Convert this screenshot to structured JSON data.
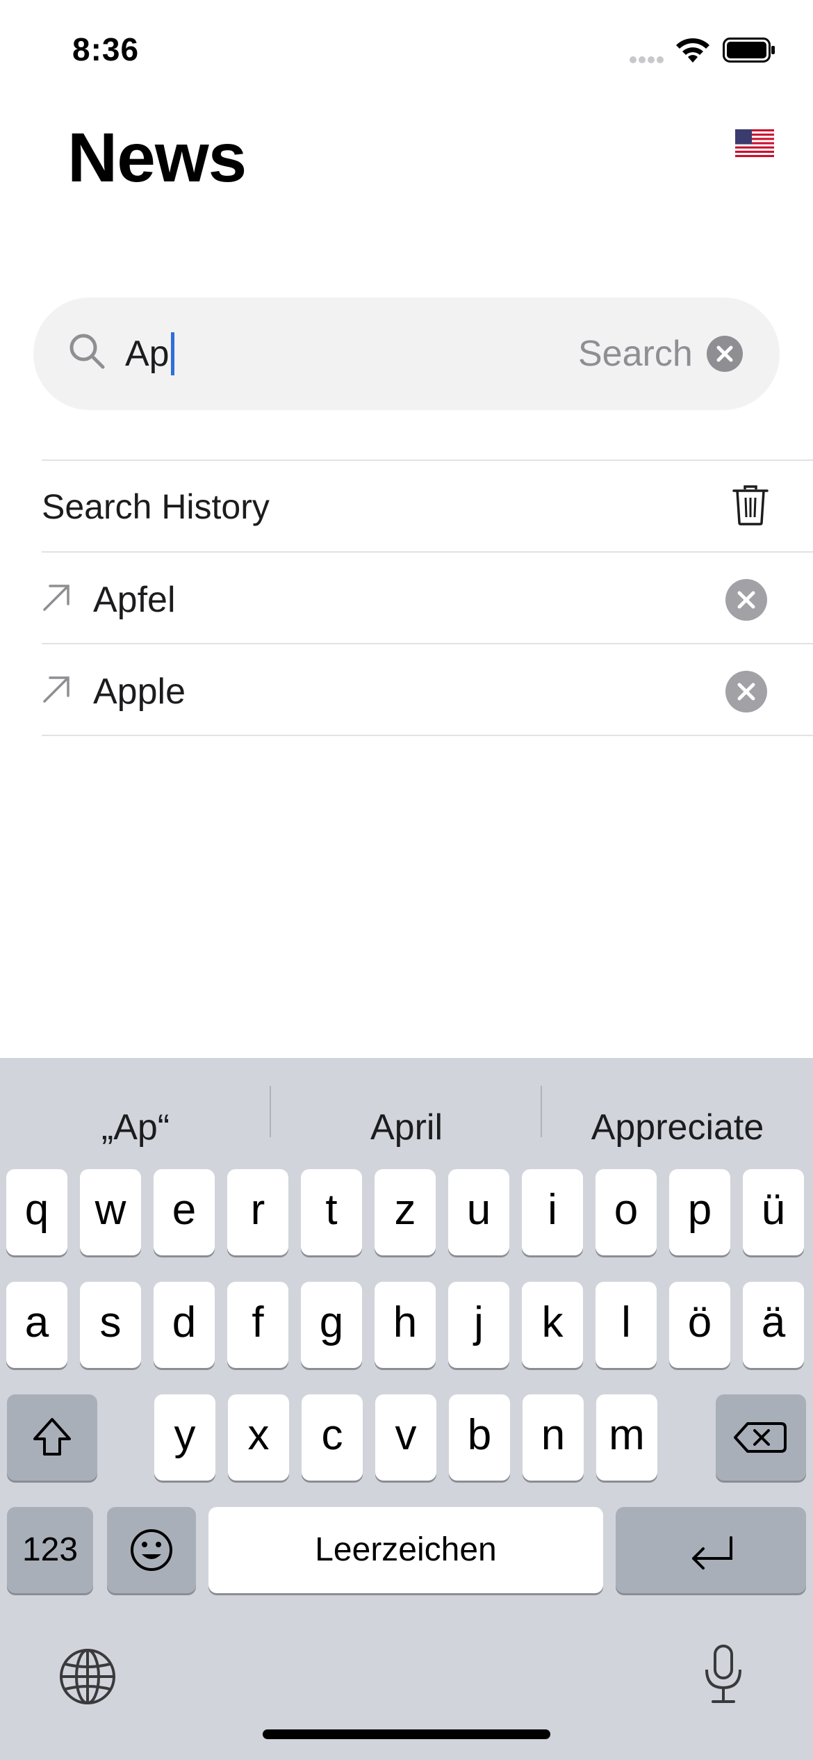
{
  "status_bar": {
    "time": "8:36"
  },
  "header": {
    "title": "News",
    "flag_icon": "us-flag-icon"
  },
  "search": {
    "value": "Ap",
    "placeholder": "Search",
    "button_label": "Search"
  },
  "history": {
    "title": "Search History",
    "items": [
      {
        "label": "Apfel"
      },
      {
        "label": "Apple"
      }
    ]
  },
  "keyboard": {
    "suggestions": [
      "„Ap“",
      "April",
      "Appreciate"
    ],
    "row1": [
      "q",
      "w",
      "e",
      "r",
      "t",
      "z",
      "u",
      "i",
      "o",
      "p",
      "ü"
    ],
    "row2": [
      "a",
      "s",
      "d",
      "f",
      "g",
      "h",
      "j",
      "k",
      "l",
      "ö",
      "ä"
    ],
    "row3": [
      "y",
      "x",
      "c",
      "v",
      "b",
      "n",
      "m"
    ],
    "numbers_label": "123",
    "space_label": "Leerzeichen"
  },
  "colors": {
    "accent_caret": "#2f6fdb",
    "keyboard_bg": "#d1d4db",
    "search_bg": "#f2f2f3"
  }
}
